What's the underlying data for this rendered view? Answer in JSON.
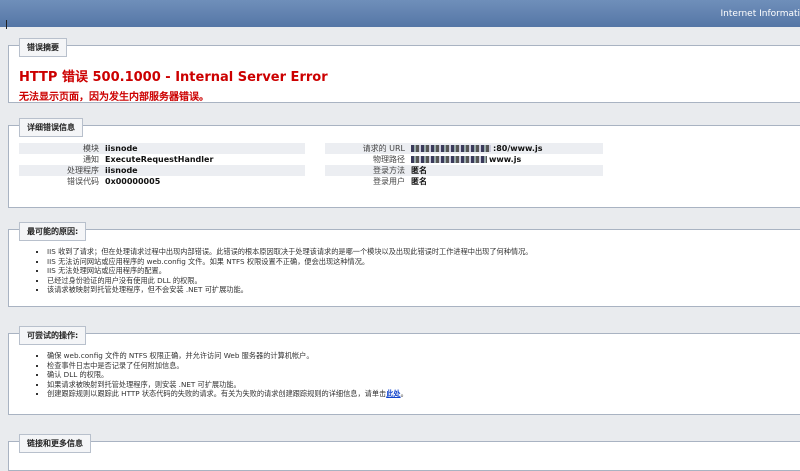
{
  "window": {
    "title": "Internet Informati"
  },
  "summary": {
    "head": "错误摘要",
    "title": "HTTP 错误  500.1000 - Internal Server Error",
    "subtitle": "无法显示页面，因为发生内部服务器错误。"
  },
  "details": {
    "head": "详细错误信息",
    "left": [
      {
        "label": "模块",
        "value": "iisnode"
      },
      {
        "label": "通知",
        "value": "ExecuteRequestHandler"
      },
      {
        "label": "处理程序",
        "value": "iisnode"
      },
      {
        "label": "错误代码",
        "value": "0x00000005"
      }
    ],
    "right": [
      {
        "label": "请求的 URL",
        "value": ":80/www.js"
      },
      {
        "label": "物理路径",
        "value": "www.js"
      },
      {
        "label": "登录方法",
        "value": "匿名"
      },
      {
        "label": "登录用户",
        "value": "匿名"
      }
    ]
  },
  "causes": {
    "head": "最可能的原因:",
    "items": [
      "IIS 收到了请求；但在处理请求过程中出现内部错误。此错误的根本原因取决于处理该请求的是哪一个模块以及出现此错误时工作进程中出现了何种情况。",
      "IIS 无法访问网站或应用程序的 web.config 文件。如果 NTFS 权限设置不正确，便会出现这种情况。",
      "IIS 无法处理网站或应用程序的配置。",
      "已经过身份验证的用户没有使用此 DLL 的权限。",
      "该请求被映射到托管处理程序，但不会安装 .NET 可扩展功能。"
    ]
  },
  "actions": {
    "head": "可尝试的操作:",
    "items": [
      "确保 web.config 文件的 NTFS 权限正确，并允许访问 Web 服务器的计算机帐户。",
      "检查事件日志中是否记录了任何附加信息。",
      "确认 DLL 的权限。",
      "如果请求被映射到托管处理程序，则安装 .NET 可扩展功能。",
      "创建跟踪规则以跟踪此 HTTP 状态代码的失败的请求。有关为失败的请求创建跟踪规则的详细信息，请单击"
    ],
    "link": "此处"
  },
  "more": {
    "head": "链接和更多信息"
  }
}
